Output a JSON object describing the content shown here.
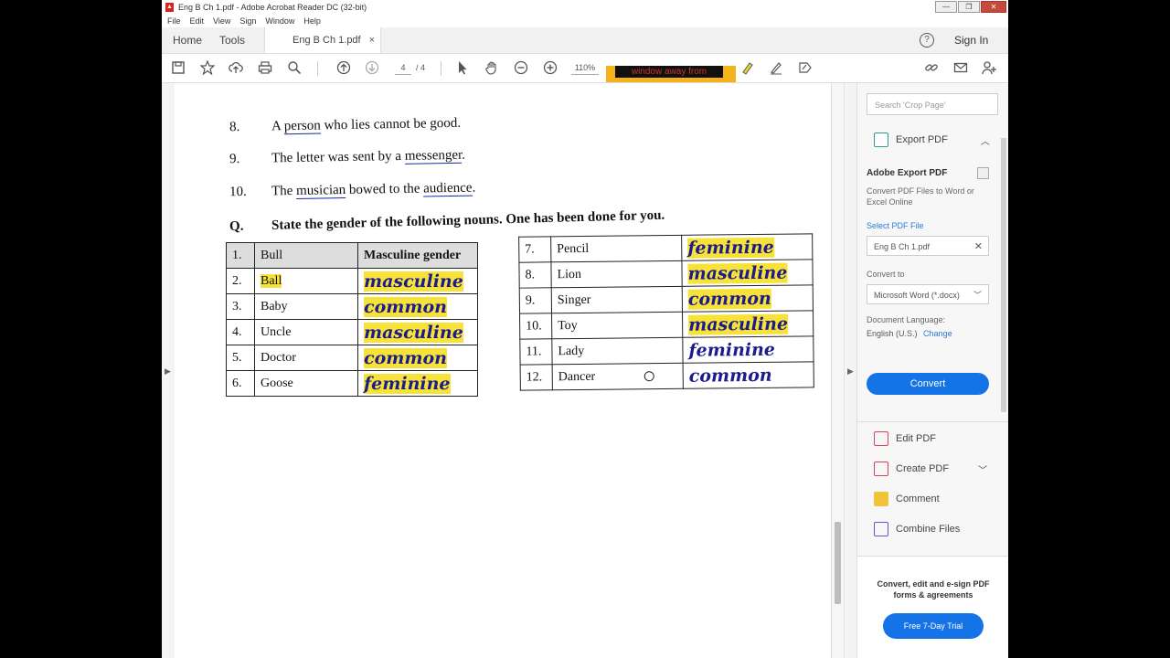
{
  "window": {
    "title": "Eng B Ch 1.pdf - Adobe Acrobat Reader DC (32-bit)",
    "controls": [
      "—",
      "❐",
      "✕"
    ]
  },
  "menu": [
    "File",
    "Edit",
    "View",
    "Sign",
    "Window",
    "Help"
  ],
  "tabs": {
    "home": "Home",
    "tools": "Tools",
    "doc": "Eng B Ch 1.pdf",
    "close": "×",
    "help": "?",
    "sign_in": "Sign In"
  },
  "toolbar": {
    "page_current": "4",
    "page_total": "/ 4",
    "zoom": "110%",
    "overlay_text": "window away from"
  },
  "document": {
    "sentences": [
      {
        "num": "8.",
        "pre": "A ",
        "u": "person",
        "post": " who lies cannot be good."
      },
      {
        "num": "9.",
        "pre": "The letter was sent by a ",
        "u": "messenger",
        "post": "."
      },
      {
        "num": "10.",
        "pre": "The ",
        "u": "musician",
        "post": " bowed to the ",
        "u2": "audience",
        "post2": "."
      }
    ],
    "question_label": "Q.",
    "question_text": "State the gender of the following nouns. One has been done for you.",
    "left_table": {
      "header": {
        "num": "1.",
        "noun": "Bull",
        "gender": "Masculine gender"
      },
      "rows": [
        {
          "num": "2.",
          "noun": "Ball",
          "answer": "masculine"
        },
        {
          "num": "3.",
          "noun": "Baby",
          "answer": "common"
        },
        {
          "num": "4.",
          "noun": "Uncle",
          "answer": "masculine"
        },
        {
          "num": "5.",
          "noun": "Doctor",
          "answer": "common"
        },
        {
          "num": "6.",
          "noun": "Goose",
          "answer": "feminine"
        }
      ]
    },
    "right_table": {
      "rows": [
        {
          "num": "7.",
          "noun": "Pencil",
          "answer": "feminine"
        },
        {
          "num": "8.",
          "noun": "Lion",
          "answer": "masculine"
        },
        {
          "num": "9.",
          "noun": "Singer",
          "answer": "common"
        },
        {
          "num": "10.",
          "noun": "Toy",
          "answer": "masculine"
        },
        {
          "num": "11.",
          "noun": "Lady",
          "answer": "feminine"
        },
        {
          "num": "12.",
          "noun": "Dancer",
          "answer": "common"
        }
      ]
    }
  },
  "right_panel": {
    "search_placeholder": "Search 'Crop Page'",
    "export_pdf": "Export PDF",
    "adobe_export_title": "Adobe Export PDF",
    "adobe_export_desc": "Convert PDF Files to Word or Excel Online",
    "select_pdf": "Select PDF File",
    "file_name": "Eng B Ch 1.pdf",
    "convert_to_label": "Convert to",
    "convert_to_value": "Microsoft Word (*.docx)",
    "doc_lang_label": "Document Language:",
    "doc_lang_value": "English (U.S.)",
    "change": "Change",
    "convert_button": "Convert",
    "tools": [
      "Edit PDF",
      "Create PDF",
      "Comment",
      "Combine Files"
    ],
    "promo": "Convert, edit and e-sign PDF forms & agreements",
    "trial_button": "Free 7-Day Trial"
  },
  "colors": {
    "accent": "#1473e6",
    "highlight": "#f7e23a",
    "ink": "#1b1b8c"
  }
}
